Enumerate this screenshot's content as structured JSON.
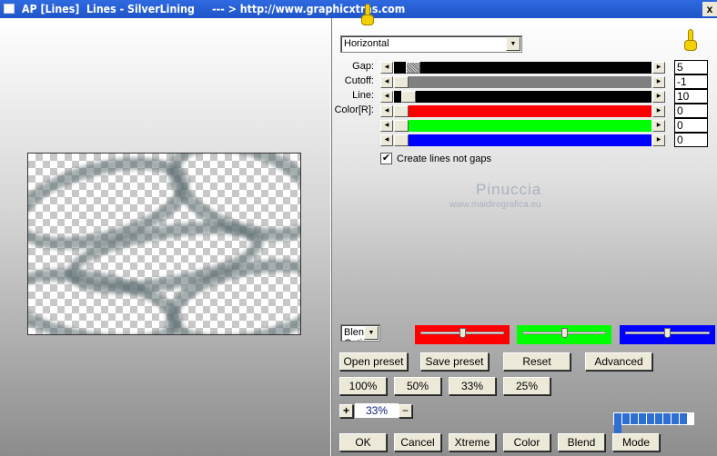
{
  "window": {
    "title": "AP [Lines]  Lines - SilverLining     --- > http://www.graphicxtras.com",
    "close_label": "x"
  },
  "controls": {
    "mode_select": "Horizontal",
    "sliders": [
      {
        "label": "Gap:",
        "value": "5",
        "color": "#000000",
        "position": 0.05
      },
      {
        "label": "Cutoff:",
        "value": "-1",
        "color": "#808080",
        "position": 0.0
      },
      {
        "label": "Line:",
        "value": "10",
        "color": "#000000",
        "position": 0.03
      },
      {
        "label": "Color[R]:",
        "value": "0",
        "color": "#ff0000",
        "position": 0.0
      },
      {
        "label": "",
        "value": "0",
        "color": "#00ff00",
        "position": 0.0
      },
      {
        "label": "",
        "value": "0",
        "color": "#0000ff",
        "position": 0.0
      }
    ],
    "checkbox": {
      "label": "Create lines not gaps",
      "checked": true
    }
  },
  "watermark": {
    "name": "Pinuccia",
    "url": "www.maidiregrafica.eu"
  },
  "blend": {
    "select": "Blend Optio",
    "channels": [
      {
        "color": "#ff0000",
        "level": 0.5
      },
      {
        "color": "#00ff00",
        "level": 0.5
      },
      {
        "color": "#0000ff",
        "level": 0.5
      }
    ]
  },
  "buttons": {
    "open_preset": "Open preset",
    "save_preset": "Save preset",
    "reset": "Reset",
    "advanced": "Advanced"
  },
  "zoom_buttons": [
    "100%",
    "50%",
    "33%",
    "25%"
  ],
  "zoom": {
    "plus": "+",
    "value": "33%",
    "minus": "−"
  },
  "bottom": {
    "ok": "OK",
    "cancel": "Cancel",
    "xtreme": "Xtreme",
    "color": "Color",
    "blend": "Blend",
    "mode": "Mode"
  }
}
